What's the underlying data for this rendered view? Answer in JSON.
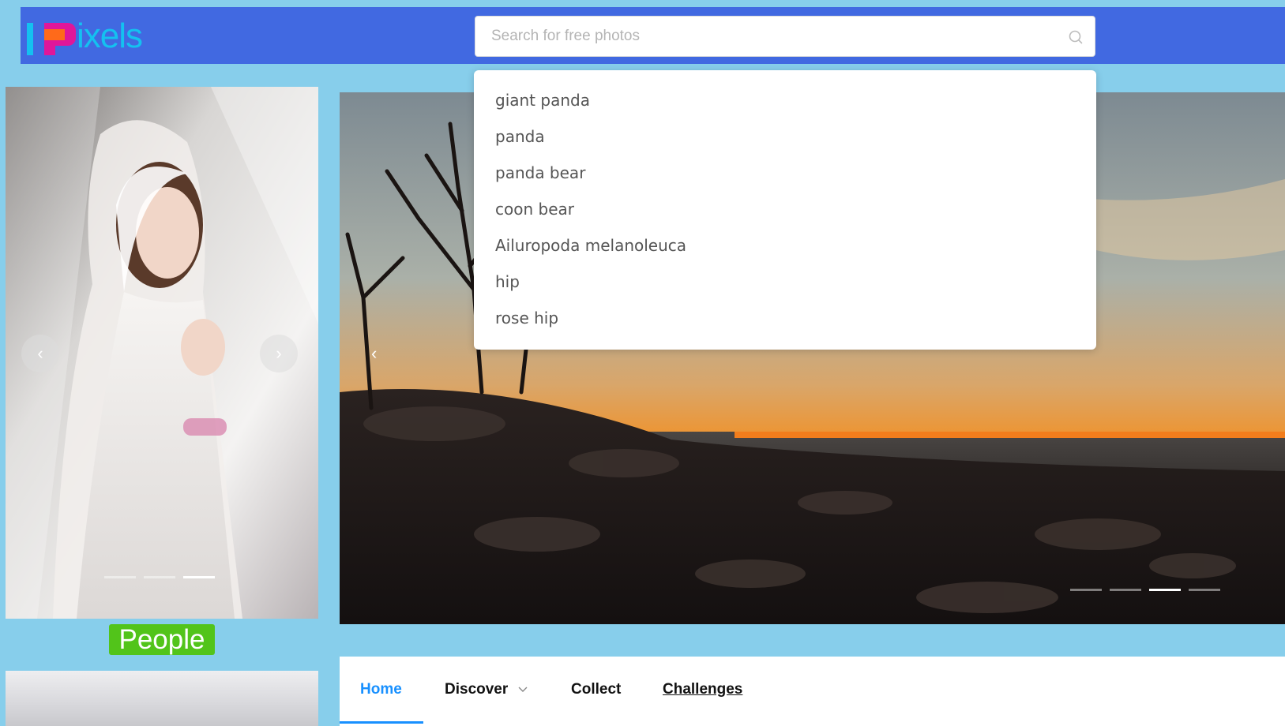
{
  "brand": {
    "logo_text": "ixels"
  },
  "search": {
    "placeholder": "Search for free photos",
    "value": ""
  },
  "suggestions": [
    "giant panda",
    "panda",
    "panda bear",
    "coon bear",
    "Ailuropoda melanoleuca",
    "hip",
    "rose hip"
  ],
  "left_carousel": {
    "category_label": "People",
    "slide_count": 3,
    "active_slide": 3
  },
  "hero_carousel": {
    "slide_count": 4,
    "active_slide": 3
  },
  "nav": {
    "home": "Home",
    "discover": "Discover",
    "collect": "Collect",
    "challenges": "Challenges",
    "active": "Home"
  },
  "colors": {
    "page_bg": "#87ceeb",
    "header_bg": "#4169e1",
    "accent": "#1890ff",
    "category_badge": "#52c41a",
    "logo_cyan": "#14c1f0",
    "logo_magenta": "#e0169a",
    "logo_orange": "#ff6a1a"
  },
  "icons": {
    "search": "search-icon",
    "prev": "chevron-left-icon",
    "next": "chevron-right-icon",
    "dropdown": "chevron-down-icon"
  }
}
